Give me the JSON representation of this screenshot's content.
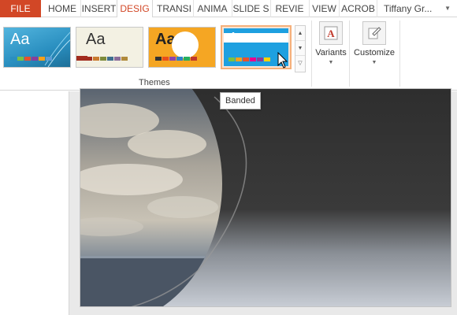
{
  "tabs": {
    "file": "FILE",
    "home": "HOME",
    "insert": "INSERT",
    "design": "DESIG",
    "transitions": "TRANSI",
    "animations": "ANIMA",
    "slideshow": "SLIDE S",
    "review": "REVIE",
    "view": "VIEW",
    "acrobat": "ACROB"
  },
  "user": {
    "name": "Tiffany Gr..."
  },
  "themes": {
    "group_label": "Themes",
    "thumb_text": "Aa",
    "items": [
      {
        "name": "theme-1",
        "bg": "#2a8fc0",
        "fg": "#ffffff"
      },
      {
        "name": "theme-2",
        "bg": "#f3f1e3",
        "fg": "#333333"
      },
      {
        "name": "theme-3",
        "bg": "#f5a623",
        "fg": "#222222"
      },
      {
        "name": "theme-banded",
        "bg": "#1ea0e0",
        "fg": "#ffffff"
      }
    ]
  },
  "buttons": {
    "variants": "Variants",
    "customize": "Customize"
  },
  "tooltip": "Banded",
  "colors": {
    "accent": "#d24726",
    "hover": "#f5b07a"
  }
}
